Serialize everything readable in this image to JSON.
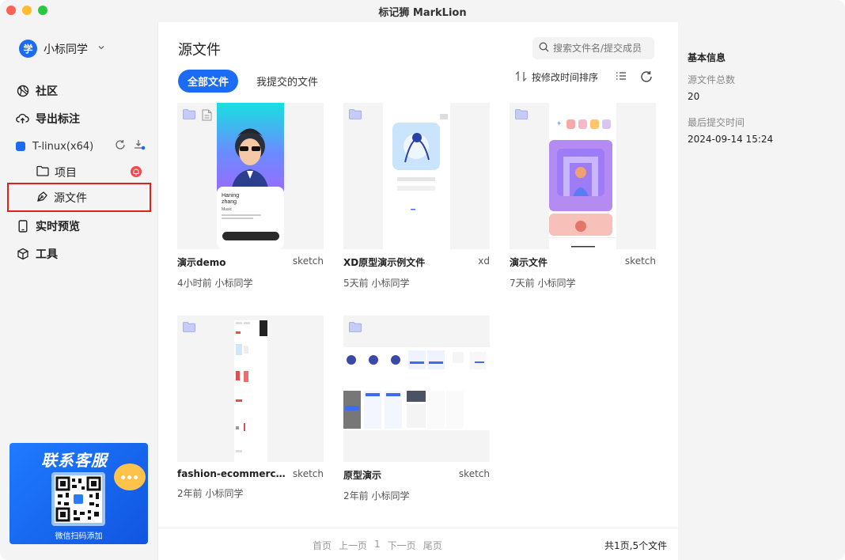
{
  "window": {
    "title": "标记狮 MarkLion"
  },
  "user": {
    "avatar_text": "学",
    "name": "小标同学"
  },
  "nav": {
    "community": "社区",
    "export": "导出标注",
    "project_name": "T-linux(x64)",
    "projects": "项目",
    "source_files": "源文件",
    "preview": "实时预览",
    "tools": "工具"
  },
  "promo": {
    "title": "联系客服",
    "subtitle": "微信扫码添加"
  },
  "main": {
    "title": "源文件",
    "search_placeholder": "搜索文件名/提交成员",
    "tabs": [
      "全部文件",
      "我提交的文件"
    ],
    "sort_label": "按修改时间排序"
  },
  "files": [
    {
      "name": "演示demo",
      "type": "sketch",
      "time": "4小时前",
      "owner": "小标同学"
    },
    {
      "name": "XD原型演示例文件",
      "type": "xd",
      "time": "5天前",
      "owner": "小标同学"
    },
    {
      "name": "演示文件",
      "type": "sketch",
      "time": "7天前",
      "owner": "小标同学"
    },
    {
      "name": "fashion-ecommerce-u...",
      "type": "sketch",
      "time": "2年前",
      "owner": "小标同学"
    },
    {
      "name": "原型演示",
      "type": "sketch",
      "time": "2年前",
      "owner": "小标同学"
    }
  ],
  "pager": {
    "first": "首页",
    "prev": "上一页",
    "current": "1",
    "next": "下一页",
    "last": "尾页",
    "total": "共1页,5个文件"
  },
  "info": {
    "title": "基本信息",
    "count_label": "源文件总数",
    "count_value": "20",
    "last_label": "最后提交时间",
    "last_value": "2024-09-14 15:24"
  },
  "colors": {
    "accent": "#1b6cf2",
    "highlight": "#e0201b",
    "folder": "#c6cbf7"
  }
}
